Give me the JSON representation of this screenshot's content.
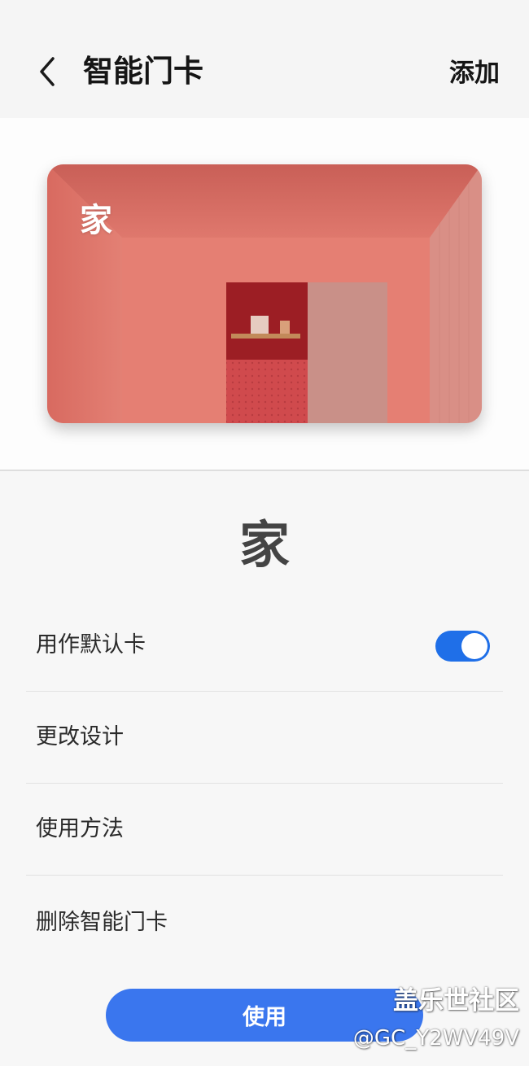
{
  "header": {
    "title": "智能门卡",
    "add_label": "添加",
    "back_icon": "chevron-left-icon"
  },
  "card": {
    "name": "家",
    "background_color": "#e07a70"
  },
  "details": {
    "title": "家"
  },
  "menu": {
    "default_card_label": "用作默认卡",
    "default_card_enabled": true,
    "change_design_label": "更改设计",
    "how_to_use_label": "使用方法",
    "delete_label": "删除智能门卡"
  },
  "use_button": {
    "label": "使用",
    "color": "#3a76ee"
  },
  "toggle_color": "#1f6fe8",
  "watermark": {
    "line1": "盖乐世社区",
    "line2": "@GC_Y2WV49V"
  }
}
